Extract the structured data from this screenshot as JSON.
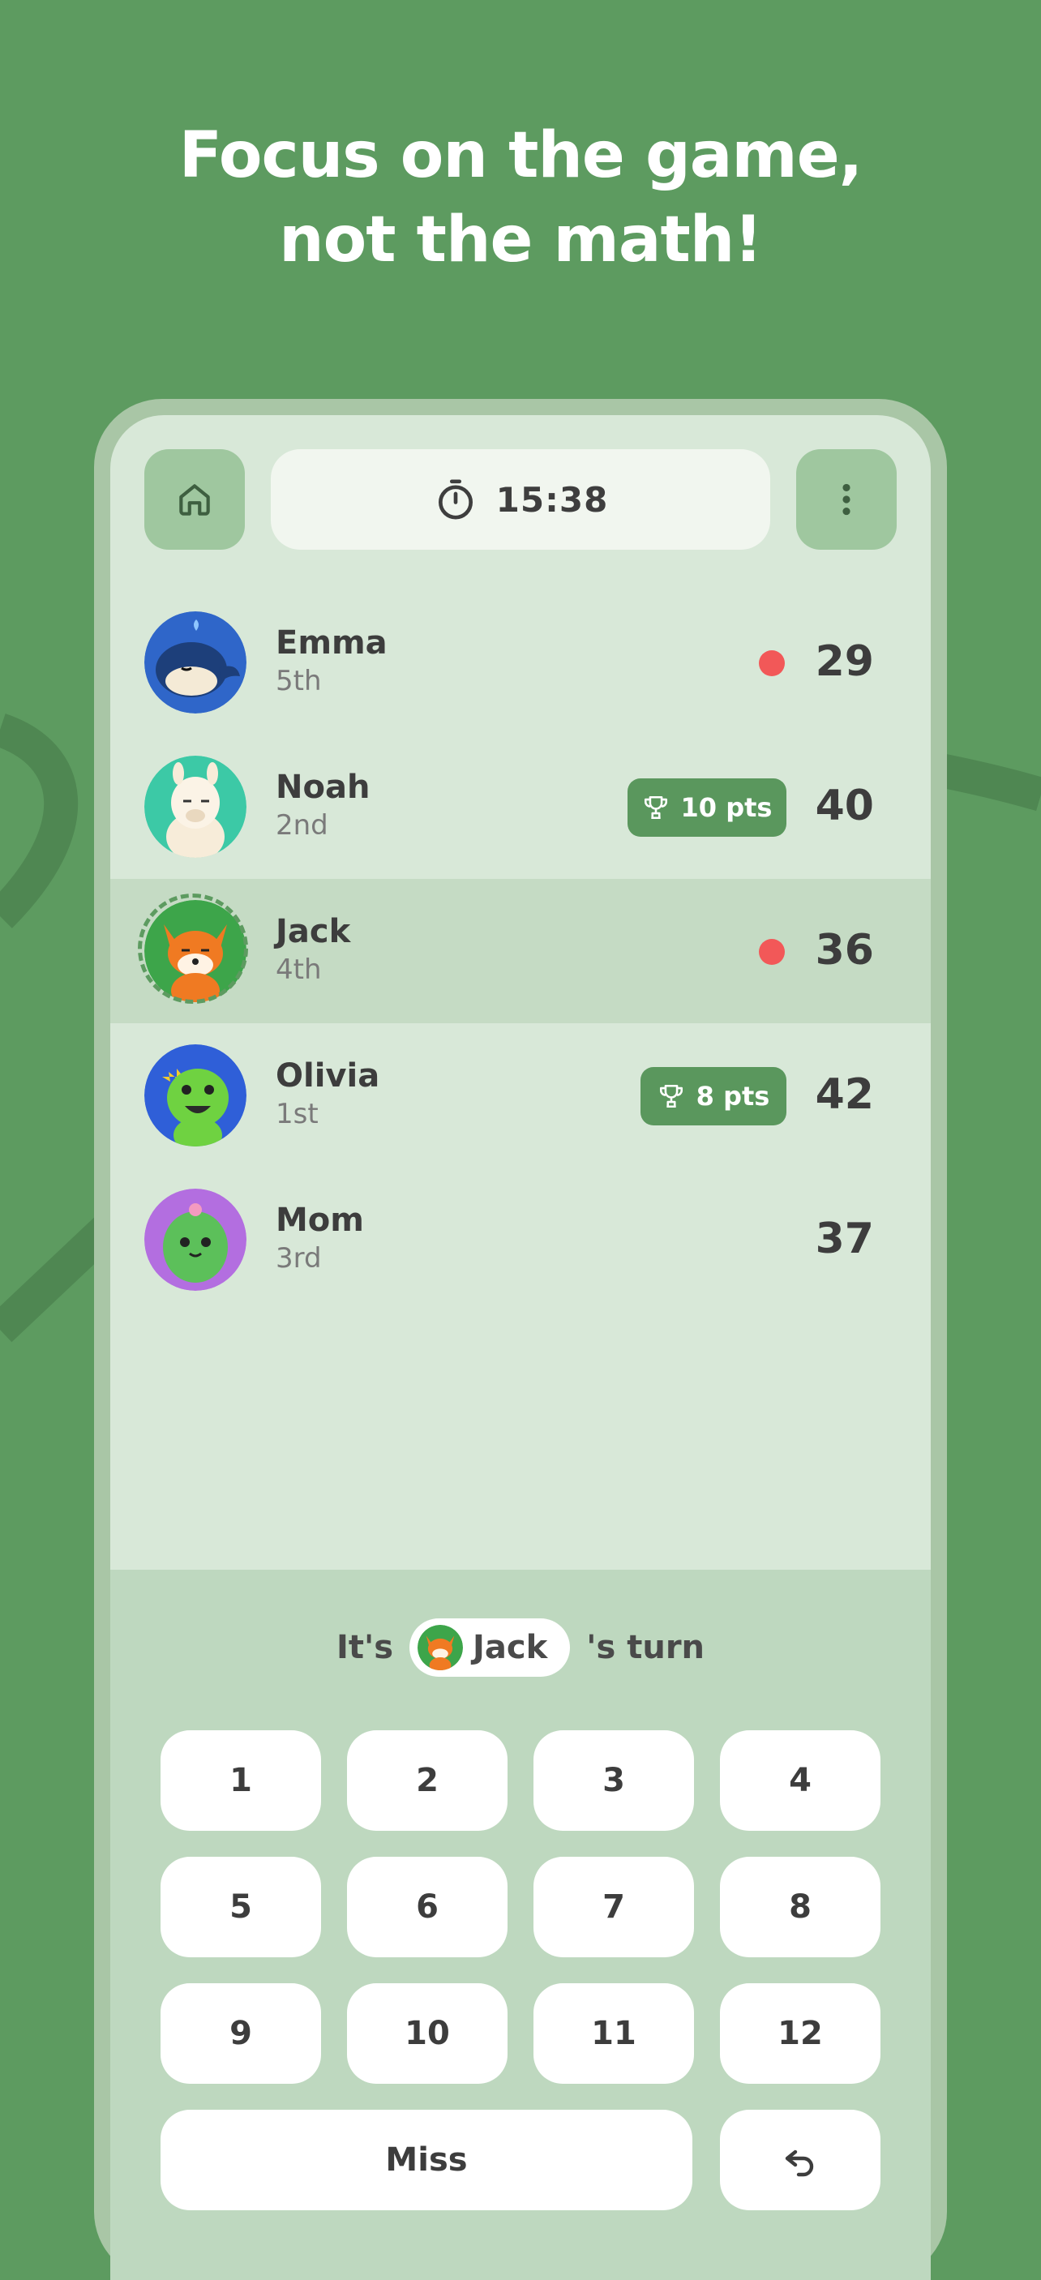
{
  "headline": {
    "line1": "Focus on the game,",
    "line2": "not the math!"
  },
  "topbar": {
    "home_icon": "home-icon",
    "timer_icon": "stopwatch-icon",
    "timer": "15:38",
    "more_icon": "more-vertical-icon"
  },
  "players": [
    {
      "name": "Emma",
      "rank": "5th",
      "score": "29",
      "avatar": "whale-avatar",
      "indicator": "red-dot"
    },
    {
      "name": "Noah",
      "rank": "2nd",
      "score": "40",
      "avatar": "llama-avatar",
      "badge": "10 pts"
    },
    {
      "name": "Jack",
      "rank": "4th",
      "score": "36",
      "avatar": "fox-avatar",
      "indicator": "red-dot",
      "active": true
    },
    {
      "name": "Olivia",
      "rank": "1st",
      "score": "42",
      "avatar": "dinosaur-avatar",
      "badge": "8 pts"
    },
    {
      "name": "Mom",
      "rank": "3rd",
      "score": "37",
      "avatar": "cactus-avatar"
    }
  ],
  "turn": {
    "prefix": "It's",
    "player": "Jack",
    "suffix": "'s turn"
  },
  "keypad": {
    "keys": [
      "1",
      "2",
      "3",
      "4",
      "5",
      "6",
      "7",
      "8",
      "9",
      "10",
      "11",
      "12"
    ],
    "miss": "Miss",
    "undo_icon": "undo-icon"
  },
  "colors": {
    "background": "#5d9b60",
    "accent": "#5a975d",
    "alert": "#f25858"
  }
}
